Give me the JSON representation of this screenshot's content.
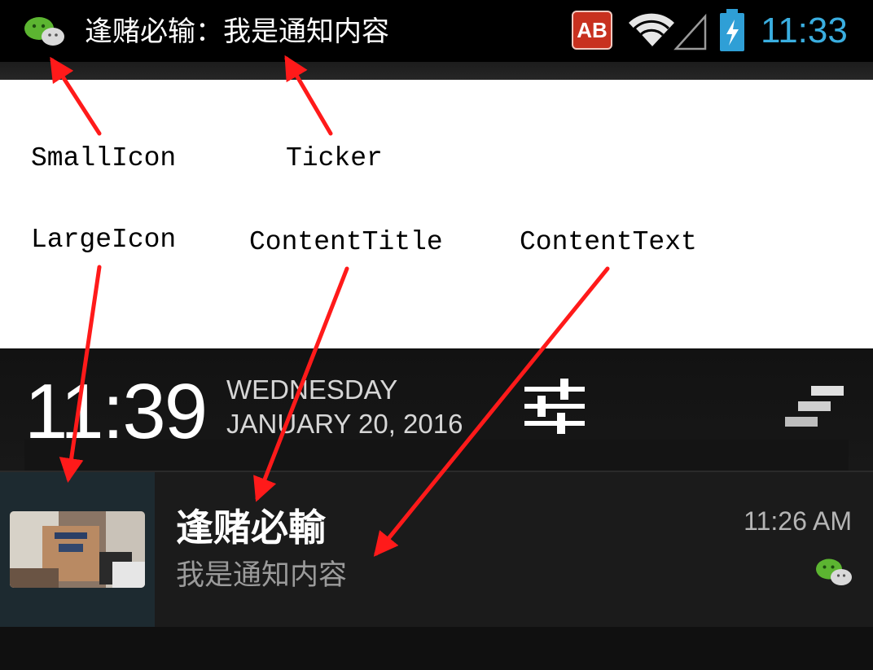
{
  "status_bar": {
    "small_icon": "wechat-icon",
    "ticker": "逢赌必输：我是通知内容",
    "badge": "AB",
    "time": "11:33",
    "colors": {
      "background": "#000000",
      "time": "#3aaee0",
      "badge": "#c8311f",
      "battery": "#2f9fd6"
    }
  },
  "labels": {
    "small_icon": "SmallIcon",
    "ticker": "Ticker",
    "large_icon": "LargeIcon",
    "content_title": "ContentTitle",
    "content_text": "ContentText"
  },
  "shade": {
    "clock": "11:39",
    "day": "WEDNESDAY",
    "date": "JANUARY 20, 2016",
    "settings_icon": "settings-sliders-icon",
    "clear_icon": "clear-all-icon"
  },
  "notification": {
    "large_icon": "room-photo",
    "title": "逢赌必輸",
    "text": "我是通知内容",
    "time": "11:26 AM",
    "small_icon": "wechat-icon"
  },
  "annotation_color": "#ff1a1a"
}
